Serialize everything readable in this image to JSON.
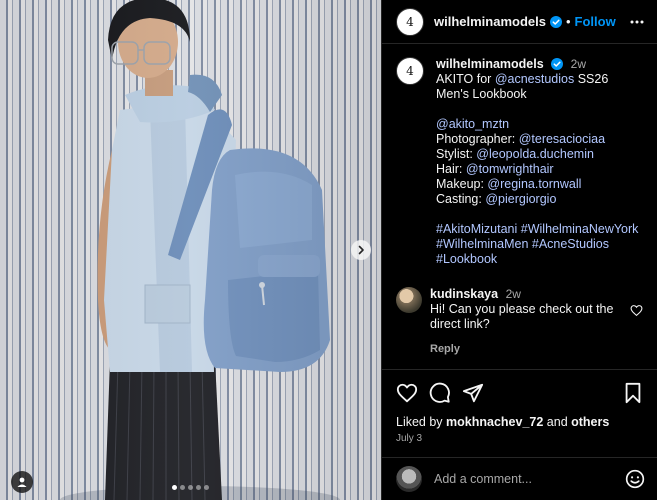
{
  "header": {
    "username": "wilhelminamodels",
    "separator": "•",
    "follow_label": "Follow",
    "avatar_text": "4"
  },
  "caption": {
    "username": "wilhelminamodels",
    "time": "2w",
    "line1_prefix": "AKITO for ",
    "line1_mention": "@acnestudios",
    "line1_suffix": " SS26 Men's Lookbook",
    "handle": "@akito_mztn",
    "photographer_label": "Photographer: ",
    "photographer": "@teresaciociaa",
    "stylist_label": "Stylist: ",
    "stylist": "@leopolda.duchemin",
    "hair_label": "Hair: ",
    "hair": "@tomwrighthair",
    "makeup_label": "Makeup: ",
    "makeup": "@regina.tornwall",
    "casting_label": "Casting: ",
    "casting": "@piergiorgio",
    "hashtags_1": "#AkitoMizutani #WilhelminaNewYork",
    "hashtags_2": "#WilhelminaMen #AcneStudios",
    "hashtags_3": "#Lookbook"
  },
  "comment": {
    "username": "kudinskaya",
    "time": "2w",
    "text": "Hi! Can you please check out the direct link?",
    "reply_label": "Reply"
  },
  "likes": {
    "prefix": "Liked by ",
    "user": "mokhnachev_72",
    "middle": " and ",
    "others": "others"
  },
  "date": "July 3",
  "add_comment": {
    "placeholder": "Add a comment..."
  },
  "carousel": {
    "total": 5,
    "active_index": 0
  },
  "icons": {
    "verified": "verified-badge-icon",
    "more": "more-horizontal-icon",
    "next": "chevron-right-icon",
    "tag": "user-tag-icon",
    "like": "heart-icon",
    "comment": "comment-bubble-icon",
    "share": "paper-plane-icon",
    "save": "bookmark-icon",
    "emoji": "emoji-icon"
  },
  "colors": {
    "accent": "#0095f6",
    "link": "#b2c7ff",
    "muted": "#a8a8a8",
    "background": "#000000"
  }
}
